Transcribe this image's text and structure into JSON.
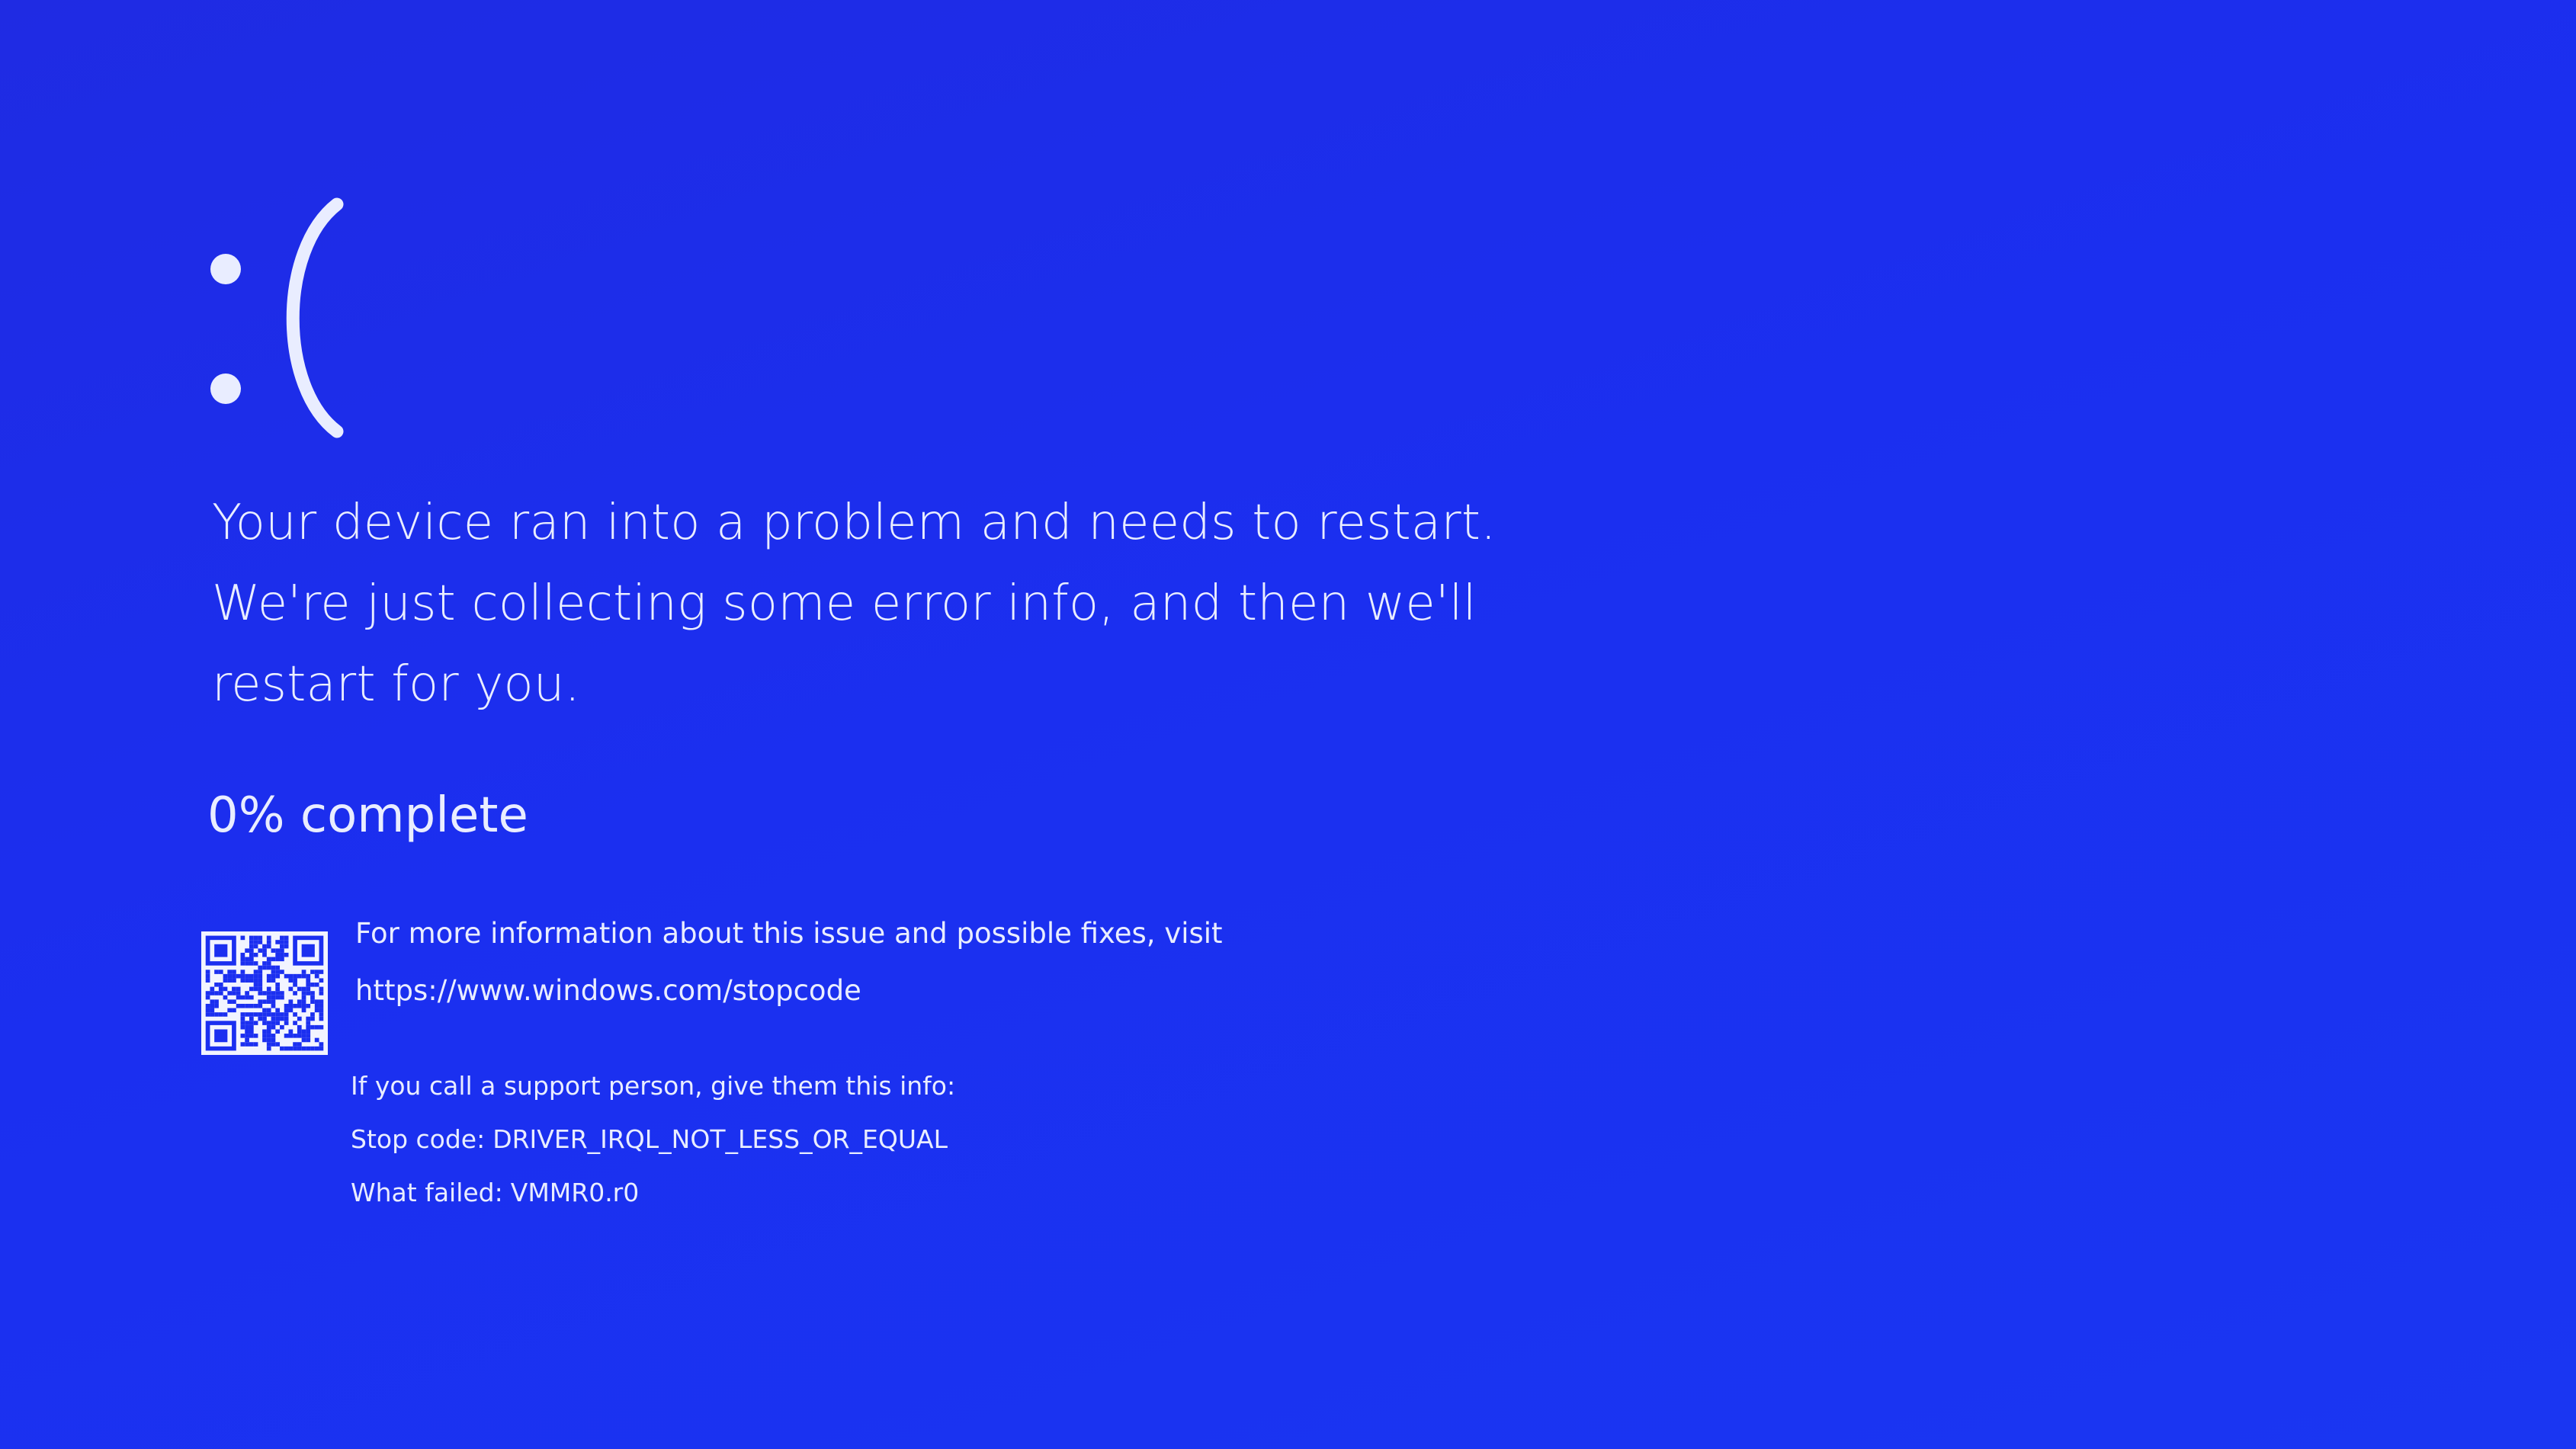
{
  "screen": {
    "emoticon": ":(",
    "message_lines": [
      "Your device ran into a problem and needs to restart.",
      "We're just collecting some error info, and then we'll",
      "restart for you."
    ],
    "progress_text": "0% complete",
    "progress_percent": 0,
    "more_info_text": "For more information about this issue and possible fixes, visit",
    "more_info_url": "https://www.windows.com/stopcode",
    "support_text": "If you call a support person, give them this info:",
    "stop_code_label": "Stop code:",
    "stop_code_value": "DRIVER_IRQL_NOT_LESS_OR_EQUAL",
    "what_failed_label": "What failed:",
    "what_failed_value": "VMMR0.r0",
    "colors": {
      "background": "#1b2ff0",
      "text": "#e9edff"
    }
  }
}
